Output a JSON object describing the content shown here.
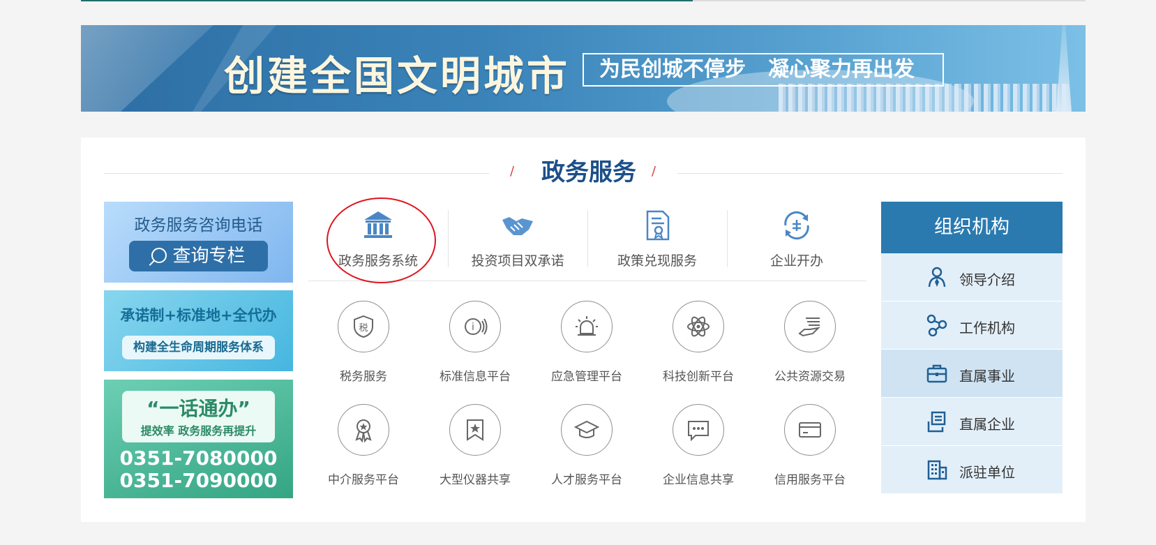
{
  "banner": {
    "title": "创建全国文明城市",
    "slogan_left": "为民创城不停步",
    "slogan_right": "凝心聚力再出发"
  },
  "section": {
    "title": "政务服务"
  },
  "promos": {
    "consult": {
      "line1": "政务服务咨询电话",
      "button": "查询专栏"
    },
    "lifecycle": {
      "line1": "承诺制+标准地+全代办",
      "line2": "构建全生命周期服务体系"
    },
    "hotline": {
      "quote": "“一话通办”",
      "sub": "提效率 政务服务再提升",
      "phone1": "0351-7080000",
      "phone2": "0351-7090000"
    }
  },
  "featured": [
    {
      "label": "政务服务系统",
      "icon": "government-building-icon"
    },
    {
      "label": "投资项目双承诺",
      "icon": "handshake-icon"
    },
    {
      "label": "政策兑现服务",
      "icon": "policy-document-icon"
    },
    {
      "label": "企业开办",
      "icon": "enterprise-cycle-icon"
    }
  ],
  "services": [
    {
      "label": "税务服务",
      "icon": "tax-shield-icon"
    },
    {
      "label": "标准信息平台",
      "icon": "info-broadcast-icon"
    },
    {
      "label": "应急管理平台",
      "icon": "alarm-light-icon"
    },
    {
      "label": "科技创新平台",
      "icon": "atom-icon"
    },
    {
      "label": "公共资源交易",
      "icon": "hand-document-icon"
    },
    {
      "label": "中介服务平台",
      "icon": "award-ribbon-icon"
    },
    {
      "label": "大型仪器共享",
      "icon": "star-bookmark-icon"
    },
    {
      "label": "人才服务平台",
      "icon": "graduation-cap-icon"
    },
    {
      "label": "企业信息共享",
      "icon": "chat-bubble-icon"
    },
    {
      "label": "信用服务平台",
      "icon": "credit-card-icon"
    }
  ],
  "org": {
    "title": "组织机构",
    "items": [
      {
        "label": "领导介绍",
        "icon": "leader-icon"
      },
      {
        "label": "工作机构",
        "icon": "network-nodes-icon"
      },
      {
        "label": "直属事业",
        "icon": "briefcase-icon"
      },
      {
        "label": "直属企业",
        "icon": "enterprise-folder-icon"
      },
      {
        "label": "派驻单位",
        "icon": "office-building-icon"
      }
    ]
  },
  "colors": {
    "brand_blue": "#2a7ab0",
    "title_blue": "#1c4f8a",
    "highlight_red": "#e0141e"
  }
}
